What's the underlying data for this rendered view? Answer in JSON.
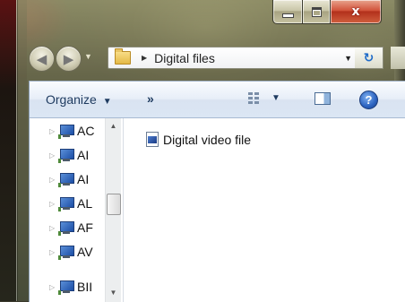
{
  "window": {
    "caption_buttons": {
      "minimize": "minimize",
      "maximize": "maximize",
      "close": "x"
    },
    "frame_color": "#7a7a5c"
  },
  "navigation": {
    "back_icon": "back-arrow-icon",
    "forward_icon": "forward-arrow-icon",
    "history_dropdown_icon": "chevron-down-icon"
  },
  "address_bar": {
    "folder_icon": "folder-icon",
    "separator": "▶",
    "crumb": "Digital files",
    "dropdown": "▼",
    "refresh": "↻"
  },
  "toolbar": {
    "organize_label": "Organize",
    "organize_arrow": "▼",
    "more_label": "»",
    "views_arrow": "▼",
    "help_label": "?"
  },
  "nav_pane": {
    "items": [
      {
        "label": "AC"
      },
      {
        "label": "AI"
      },
      {
        "label": "AI"
      },
      {
        "label": "AL"
      },
      {
        "label": "AF"
      },
      {
        "label": "AV"
      },
      {
        "label": "BII"
      }
    ],
    "scroll_up": "▲",
    "scroll_down": "▼"
  },
  "content": {
    "files": [
      {
        "name": "Digital video file",
        "icon": "video-file-icon"
      }
    ]
  }
}
